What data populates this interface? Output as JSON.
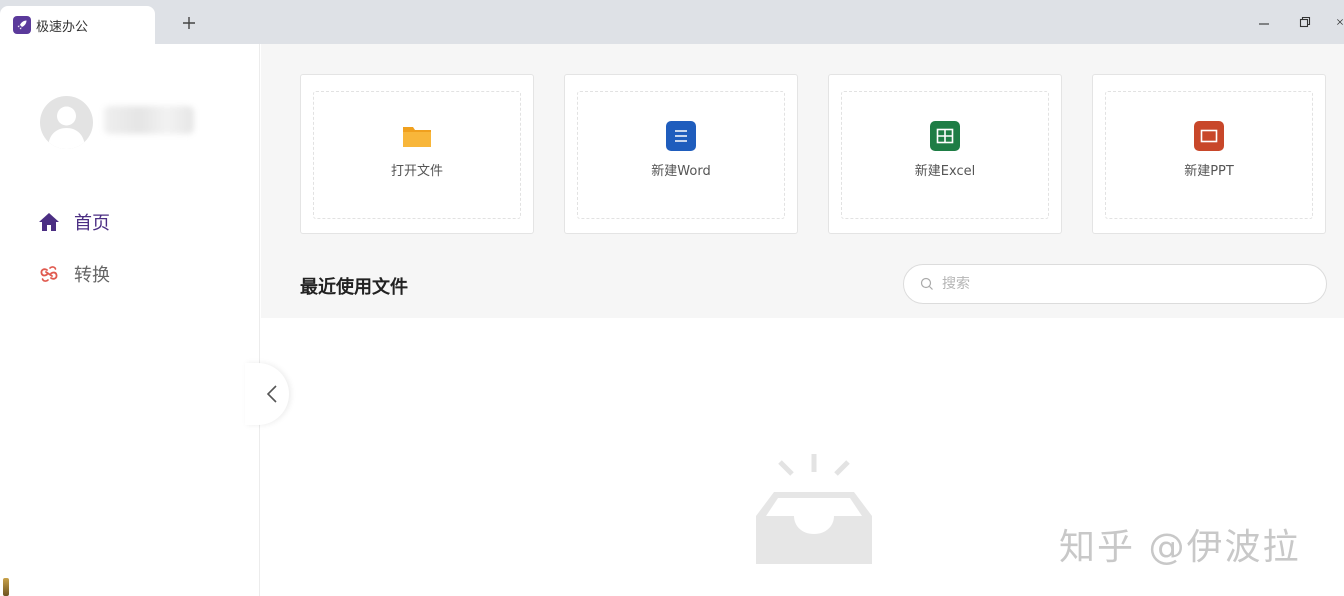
{
  "titlebar": {
    "tab_title": "极速办公",
    "new_tab_label": "+"
  },
  "sidebar": {
    "user": {
      "avatar": "user-avatar-icon"
    },
    "nav": [
      {
        "label": "首页",
        "icon": "home-icon",
        "active": true,
        "color": "#4b2e83"
      },
      {
        "label": "转换",
        "icon": "convert-icon",
        "active": false,
        "color": "#e05a4f"
      }
    ]
  },
  "actions": [
    {
      "label": "打开文件",
      "icon": "folder-icon",
      "color": "#f5a623"
    },
    {
      "label": "新建Word",
      "icon": "word-icon",
      "color": "#1f5dbd"
    },
    {
      "label": "新建Excel",
      "icon": "excel-icon",
      "color": "#1e7d45"
    },
    {
      "label": "新建PPT",
      "icon": "ppt-icon",
      "color": "#c8472a"
    }
  ],
  "recent": {
    "title": "最近使用文件",
    "search_placeholder": "搜索",
    "empty_icon": "empty-inbox-icon"
  },
  "watermark": "知乎 @伊波拉"
}
